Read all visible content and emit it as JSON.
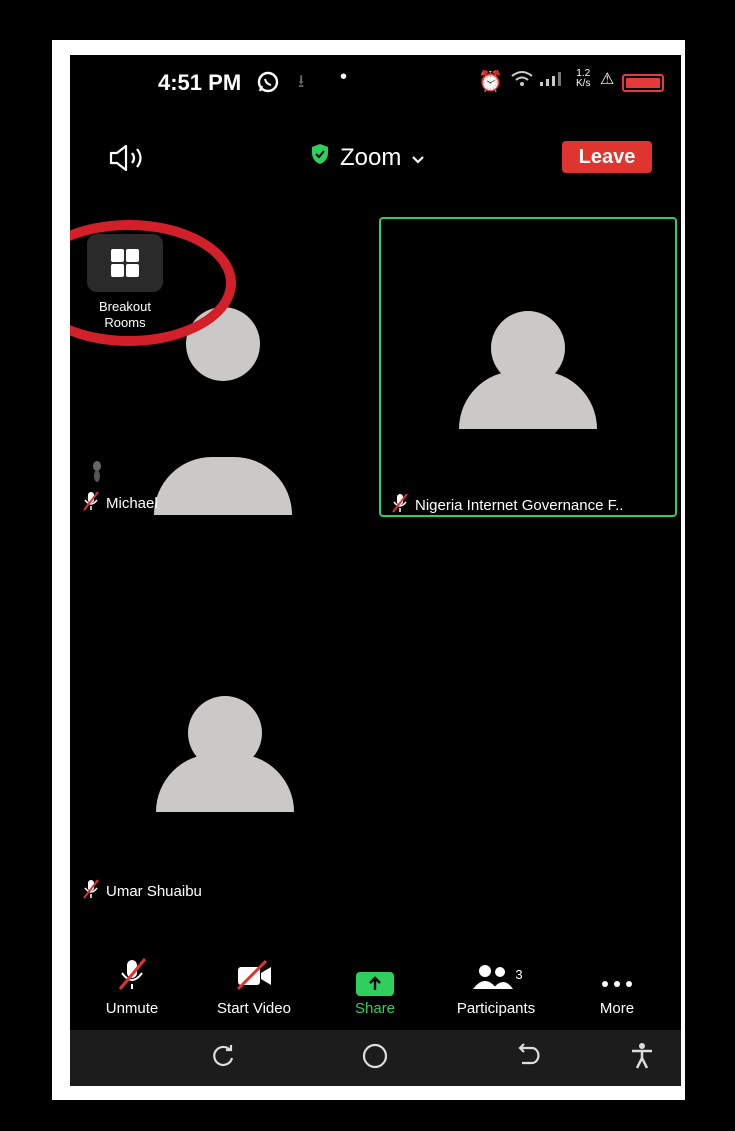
{
  "status_bar": {
    "time": "4:51 PM",
    "network_speed_value": "1.2",
    "network_speed_unit": "K/s"
  },
  "header": {
    "meeting_title": "Zoom",
    "leave_label": "Leave"
  },
  "breakout": {
    "label_line1": "Breakout",
    "label_line2": "Rooms"
  },
  "participants_tiles": [
    {
      "name": "Michael",
      "active": false
    },
    {
      "name": "Nigeria Internet Governance F..",
      "active": true
    },
    {
      "name": "Umar Shuaibu",
      "active": false
    }
  ],
  "toolbar": {
    "unmute_label": "Unmute",
    "start_video_label": "Start Video",
    "share_label": "Share",
    "participants_label": "Participants",
    "participants_count": "3",
    "more_label": "More"
  },
  "colors": {
    "accent_green": "#2fcf5d",
    "leave_red": "#e0342f",
    "highlight_red": "#d1202a",
    "avatar_grey": "#cbc8c8"
  }
}
